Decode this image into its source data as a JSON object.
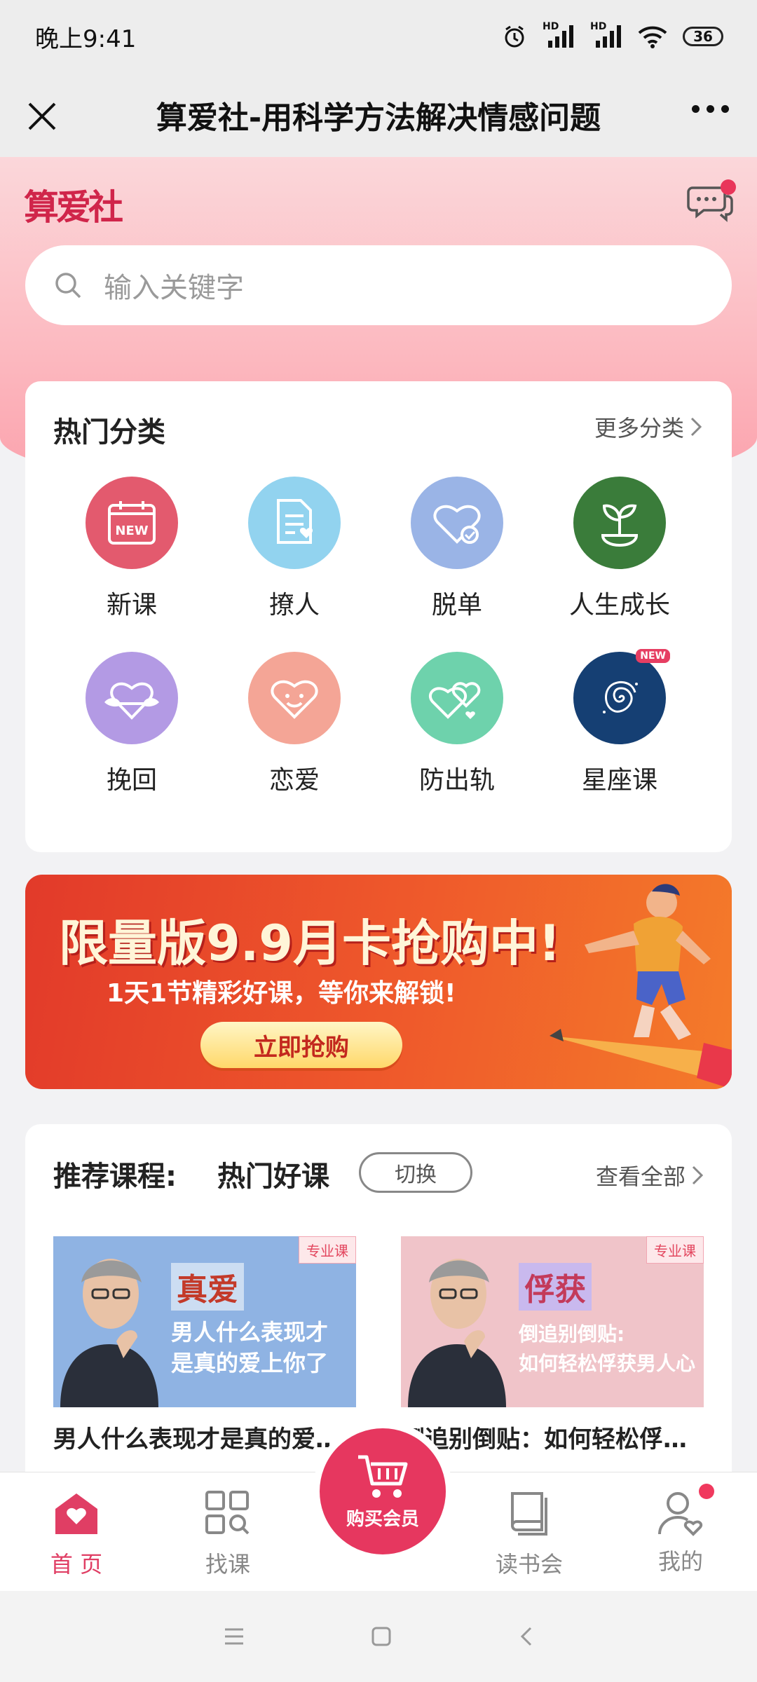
{
  "status": {
    "time": "晚上9:41",
    "hd1": "HD",
    "hd2": "HD",
    "battery": "36"
  },
  "nav": {
    "title": "算爱社-用科学方法解决情感问题"
  },
  "brand": {
    "logo_text": "算爱社"
  },
  "search": {
    "placeholder": "输入关键字"
  },
  "categories": {
    "title": "热门分类",
    "more": "更多分类",
    "items": [
      {
        "label": "新课",
        "color": "#e35a6e",
        "icon": "new-calendar-icon",
        "icon_text": "NEW"
      },
      {
        "label": "撩人",
        "color": "#92d3ef",
        "icon": "love-letter-icon"
      },
      {
        "label": "脱单",
        "color": "#9ab4e6",
        "icon": "heart-check-icon"
      },
      {
        "label": "人生成长",
        "color": "#3a7c3a",
        "icon": "sprout-icon"
      },
      {
        "label": "挽回",
        "color": "#b39ae4",
        "icon": "heart-cloud-icon"
      },
      {
        "label": "恋爱",
        "color": "#f4a596",
        "icon": "smiling-heart-icon"
      },
      {
        "label": "防出轨",
        "color": "#6ed2ac",
        "icon": "double-heart-icon"
      },
      {
        "label": "星座课",
        "color": "#153f73",
        "icon": "galaxy-icon",
        "badge": "NEW"
      }
    ]
  },
  "banner": {
    "title": "限量版9.9月卡抢购中!",
    "subtitle": "1天1节精彩好课，等你来解锁!",
    "button": "立即抢购"
  },
  "recommend": {
    "title": "推荐课程:",
    "tab": "热门好课",
    "switch": "切换",
    "more": "查看全部",
    "courses": [
      {
        "tag": "专业课",
        "key": "真爱",
        "line1": "男人什么表现才",
        "line2": "是真的爱上你了",
        "name": "男人什么表现才是真的爱…",
        "bg": "#8fb3e3"
      },
      {
        "tag": "专业课",
        "key": "俘获",
        "line1": "倒追别倒贴:",
        "line2": "如何轻松俘获男人心",
        "name": "倒追别倒贴：如何轻松俘…",
        "bg": "#f0c4c9"
      }
    ]
  },
  "tabbar": {
    "home": "首 页",
    "find": "找课",
    "buy": "购买会员",
    "reading": "读书会",
    "mine": "我的"
  }
}
